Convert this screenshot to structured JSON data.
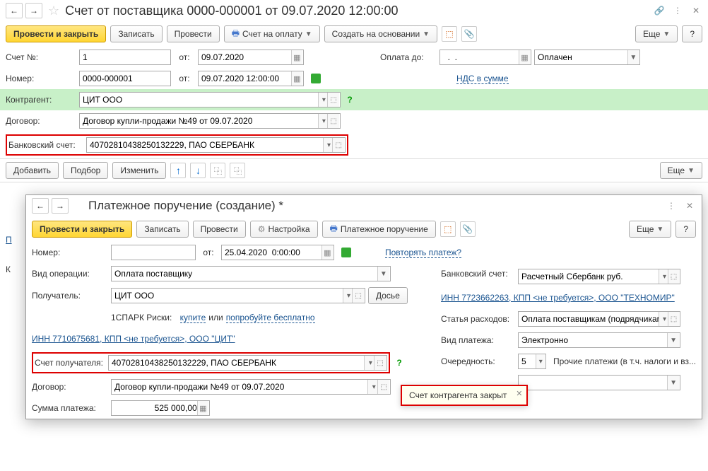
{
  "win1": {
    "title": "Счет от поставщика 0000-000001 от 09.07.2020 12:00:00",
    "toolbar": {
      "post_close": "Провести и закрыть",
      "write": "Записать",
      "post": "Провести",
      "print_invoice": "Счет на оплату",
      "create_based": "Создать на основании",
      "more": "Еще",
      "help": "?"
    },
    "labels": {
      "invoice_no": "Счет №:",
      "from": "от:",
      "payment_due": "Оплата до:",
      "number": "Номер:",
      "counterparty": "Контрагент:",
      "contract": "Договор:",
      "bank_account": "Банковский счет:"
    },
    "values": {
      "invoice_no": "1",
      "invoice_date": "09.07.2020",
      "payment_due": "  .  .",
      "status": "Оплачен",
      "number": "0000-000001",
      "number_date": "09.07.2020 12:00:00",
      "vat_link": "НДС в сумме",
      "counterparty": "ЦИТ ООО",
      "contract": "Договор купли-продажи №49 от 09.07.2020",
      "bank_account": "40702810438250132229, ПАО СБЕРБАНК"
    },
    "list_toolbar": {
      "add": "Добавить",
      "pick": "Подбор",
      "change": "Изменить",
      "more": "Еще"
    }
  },
  "win2": {
    "title": "Платежное поручение (создание) *",
    "toolbar": {
      "post_close": "Провести и закрыть",
      "write": "Записать",
      "post": "Провести",
      "settings": "Настройка",
      "payment_order": "Платежное поручение",
      "more": "Еще",
      "help": "?"
    },
    "labels": {
      "number": "Номер:",
      "from": "от:",
      "operation_type": "Вид операции:",
      "recipient": "Получатель:",
      "spark": "1СПАРК Риски:",
      "recipient_account": "Счет получателя:",
      "contract": "Договор:",
      "payment_amount": "Сумма платежа:",
      "bank_account": "Банковский счет:",
      "expense_item": "Статья расходов:",
      "payment_type": "Вид платежа:",
      "priority": "Очередность:"
    },
    "values": {
      "number": "",
      "date": "25.04.2020  0:00:00",
      "repeat_link": "Повторять платеж?",
      "operation_type": "Оплата поставщику",
      "recipient": "ЦИТ ООО",
      "dossier": "Досье",
      "spark_buy": "купите",
      "spark_or": " или ",
      "spark_try": "попробуйте бесплатно",
      "inn_link": "ИНН 7710675681, КПП <не требуется>, ООО \"ЦИТ\"",
      "recipient_account": "40702810438250132229, ПАО СБЕРБАНК",
      "contract": "Договор купли-продажи №49 от 09.07.2020",
      "payment_amount": "525 000,00",
      "bank_account": "Расчетный Сбербанк руб.",
      "inn_link2": "ИНН 7723662263, КПП <не требуется>, ООО \"ТЕХНОМИР\"",
      "expense_item": "Оплата поставщикам (подрядчикам)",
      "payment_type": "Электронно",
      "priority": "5",
      "priority_desc": "Прочие платежи (в т.ч. налоги и вз..."
    },
    "popup": "Счет контрагента закрыт"
  },
  "truncated": {
    "p": "П",
    "k": "К"
  }
}
